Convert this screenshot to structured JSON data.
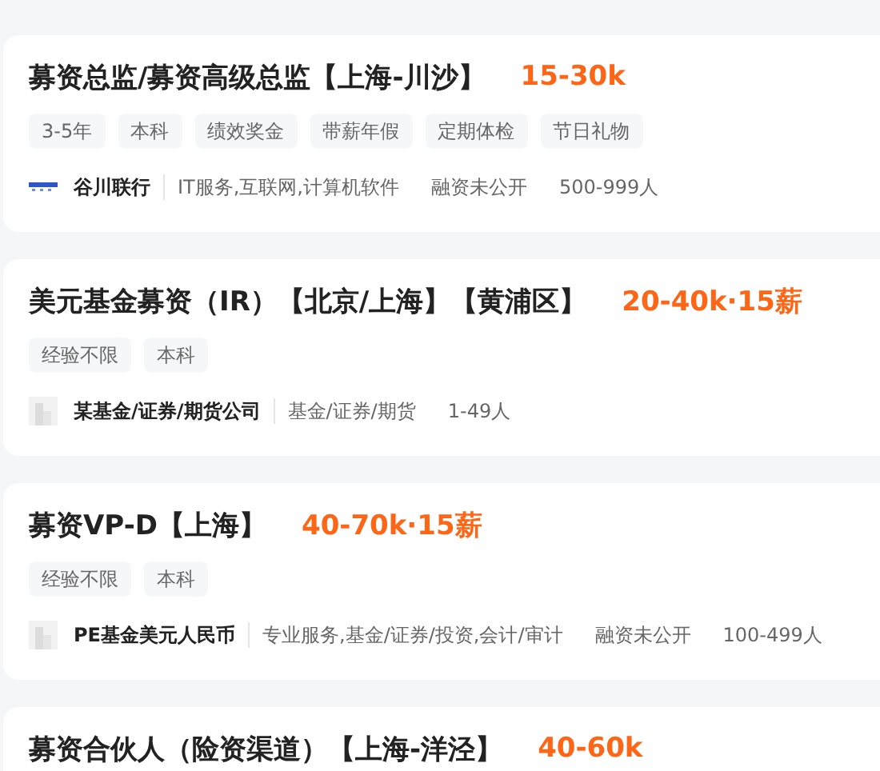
{
  "jobs": [
    {
      "title": "募资总监/募资高级总监【上海-川沙】",
      "salary": "15-30k",
      "tags": [
        "3-5年",
        "本科",
        "绩效奖金",
        "带薪年假",
        "定期体检",
        "节日礼物"
      ],
      "company": {
        "kind": "brand",
        "name": "谷川联行",
        "info": [
          "IT服务,互联网,计算机软件",
          "融资未公开",
          "500-999人"
        ]
      }
    },
    {
      "title": "美元基金募资（IR）【北京/上海】【黄浦区】",
      "salary": "20-40k·15薪",
      "tags": [
        "经验不限",
        "本科"
      ],
      "company": {
        "kind": "placeholder",
        "name": "某基金/证券/期货公司",
        "info": [
          "基金/证券/期货",
          "1-49人"
        ]
      }
    },
    {
      "title": "募资VP-D【上海】",
      "salary": "40-70k·15薪",
      "tags": [
        "经验不限",
        "本科"
      ],
      "company": {
        "kind": "placeholder",
        "name": "PE基金美元人民币",
        "info": [
          "专业服务,基金/证券/投资,会计/审计",
          "融资未公开",
          "100-499人"
        ]
      }
    },
    {
      "title": "募资合伙人（险资渠道）【上海-洋泾】",
      "salary": "40-60k"
    }
  ]
}
